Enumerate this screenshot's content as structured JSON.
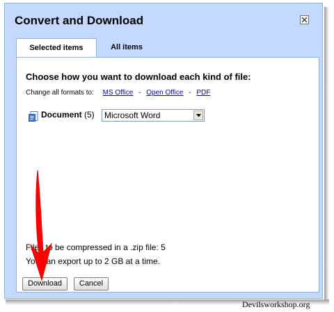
{
  "dialog": {
    "title": "Convert and Download",
    "close_icon": "close-icon",
    "tabs": [
      {
        "label": "Selected items",
        "active": true
      },
      {
        "label": "All items",
        "active": false
      }
    ],
    "heading": "Choose how you want to download each kind of file:",
    "change_all": {
      "label": "Change all formats to:",
      "links": [
        "MS Office",
        "Open Office",
        "PDF"
      ],
      "separator": "-"
    },
    "document_row": {
      "icon": "document-icon",
      "label": "Document",
      "count": "(5)",
      "selected_format": "Microsoft Word"
    },
    "info_line_1": "Files to be compressed in a .zip file: 5",
    "info_line_2": "You can export up to 2 GB at a time.",
    "buttons": {
      "download": "Download",
      "cancel": "Cancel"
    }
  },
  "annotation": {
    "arrow_color": "#ff0000"
  },
  "watermark": "Devilsworkshop.org",
  "colors": {
    "frame": "#c3d9ff",
    "link": "#0000cc",
    "border": "#8fb0d8"
  }
}
